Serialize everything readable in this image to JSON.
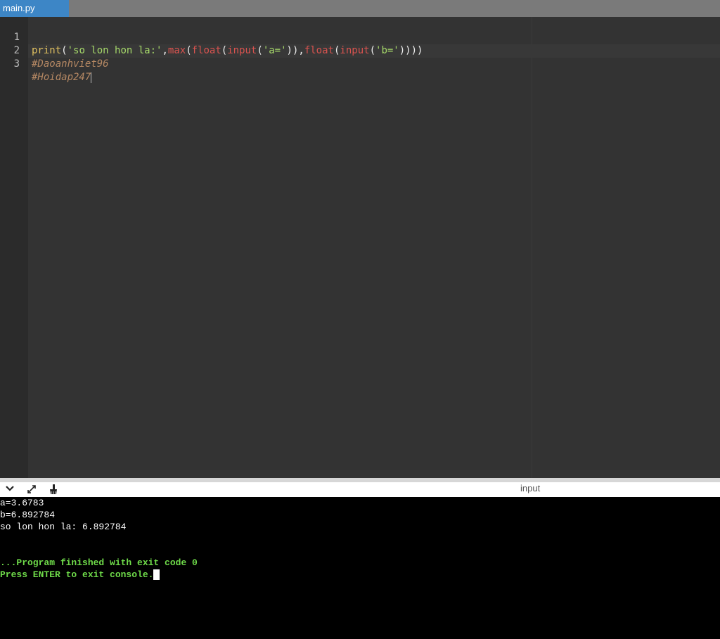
{
  "tabs": [
    {
      "label": "main.py",
      "active": true
    }
  ],
  "editor": {
    "lines": [
      {
        "number": "1",
        "tokens": [
          {
            "text": "print",
            "type": "func"
          },
          {
            "text": "(",
            "type": "paren"
          },
          {
            "text": "'so lon hon la:'",
            "type": "str"
          },
          {
            "text": ",",
            "type": "paren"
          },
          {
            "text": "max",
            "type": "builtin"
          },
          {
            "text": "(",
            "type": "paren"
          },
          {
            "text": "float",
            "type": "builtin"
          },
          {
            "text": "(",
            "type": "paren"
          },
          {
            "text": "input",
            "type": "builtin"
          },
          {
            "text": "(",
            "type": "paren"
          },
          {
            "text": "'a='",
            "type": "str"
          },
          {
            "text": ")),",
            "type": "paren"
          },
          {
            "text": "float",
            "type": "builtin"
          },
          {
            "text": "(",
            "type": "paren"
          },
          {
            "text": "input",
            "type": "builtin"
          },
          {
            "text": "(",
            "type": "paren"
          },
          {
            "text": "'b='",
            "type": "str"
          },
          {
            "text": "))))",
            "type": "paren"
          }
        ]
      },
      {
        "number": "2",
        "tokens": [
          {
            "text": "#Daoanhviet96",
            "type": "comment"
          }
        ]
      },
      {
        "number": "3",
        "tokens": [
          {
            "text": "#Hoidap247",
            "type": "comment"
          }
        ]
      }
    ]
  },
  "panel": {
    "collapse_icon": "chevron-down-icon",
    "expand_icon": "expand-arrows-icon",
    "clear_icon": "broom-icon",
    "input_label": "input"
  },
  "console": {
    "lines": [
      {
        "text": "a=3.6783",
        "style": "normal"
      },
      {
        "text": "b=6.892784",
        "style": "normal"
      },
      {
        "text": "so lon hon la: 6.892784",
        "style": "normal"
      },
      {
        "text": "...Program finished with exit code 0",
        "style": "green"
      },
      {
        "text": "Press ENTER to exit console.",
        "style": "green"
      }
    ]
  },
  "colors": {
    "tab_active": "#3d86c6",
    "editor_bg": "#333333",
    "console_bg": "#000000",
    "console_green": "#6fdc4a"
  }
}
